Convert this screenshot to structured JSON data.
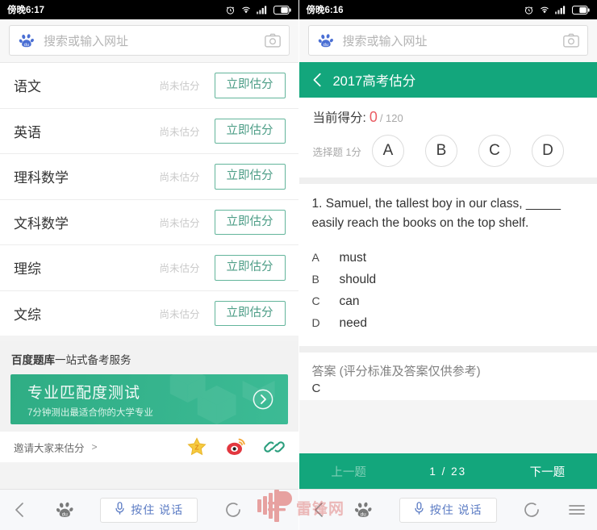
{
  "left": {
    "statusbar": {
      "time": "傍晚6:17",
      "icons": [
        "alarm-icon",
        "wifi-icon",
        "signal-icon",
        "battery-icon"
      ]
    },
    "search": {
      "placeholder": "搜索或输入网址",
      "logo": "baidu-paw-icon",
      "camera": "camera-icon"
    },
    "subjects": [
      {
        "name": "语文",
        "status": "尚未估分",
        "action": "立即估分"
      },
      {
        "name": "英语",
        "status": "尚未估分",
        "action": "立即估分"
      },
      {
        "name": "理科数学",
        "status": "尚未估分",
        "action": "立即估分"
      },
      {
        "name": "文科数学",
        "status": "尚未估分",
        "action": "立即估分"
      },
      {
        "name": "理综",
        "status": "尚未估分",
        "action": "立即估分"
      },
      {
        "name": "文综",
        "status": "尚未估分",
        "action": "立即估分"
      }
    ],
    "promo": {
      "section_title_bold": "百度题库",
      "section_title_rest": "一站式备考服务",
      "banner_title": "专业匹配度测试",
      "banner_subtitle": "7分钟测出最适合你的大学专业",
      "banner_arrow": "chevron-right-circle-icon"
    },
    "invite": {
      "label": "邀请大家来估分",
      "arrow": ">",
      "icons": [
        "qzone-star-icon",
        "weibo-icon",
        "copy-link-icon"
      ]
    },
    "browser_nav": {
      "back": "back-chevron-icon",
      "home": "baidu-paw-icon",
      "voice_label": "按住 说话",
      "mic": "microphone-icon",
      "refresh": "refresh-icon"
    }
  },
  "right": {
    "statusbar": {
      "time": "傍晚6:16",
      "icons": [
        "alarm-icon",
        "wifi-icon",
        "signal-icon",
        "battery-icon"
      ]
    },
    "search": {
      "placeholder": "搜索或输入网址",
      "logo": "baidu-paw-icon",
      "camera": "camera-icon"
    },
    "header": {
      "back": "back-chevron-icon",
      "title": "2017高考估分"
    },
    "score": {
      "label": "当前得分:",
      "value": "0",
      "total": "/ 120",
      "value_color": "#ea5c63"
    },
    "choice": {
      "label": "选择题 1分",
      "options": [
        "A",
        "B",
        "C",
        "D"
      ]
    },
    "question": {
      "stem": "1. Samuel, the tallest boy in our class, _____ easily reach the books on the top shelf.",
      "options": [
        {
          "key": "A",
          "text": "must"
        },
        {
          "key": "B",
          "text": "should"
        },
        {
          "key": "C",
          "text": "can"
        },
        {
          "key": "D",
          "text": "need"
        }
      ]
    },
    "answer": {
      "title": "答案 (评分标准及答案仅供参考)",
      "value": "C"
    },
    "pager": {
      "prev": "上一题",
      "index": "1 / 23",
      "next": "下一题"
    },
    "browser_nav": {
      "back": "back-chevron-icon",
      "home": "baidu-paw-icon",
      "voice_label": "按住 说话",
      "mic": "microphone-icon",
      "refresh": "refresh-icon",
      "menu": "hamburger-menu-icon"
    }
  },
  "watermark": {
    "text": "雷锋网",
    "logo": "leiphone-logo-icon",
    "color": "#d9524f"
  },
  "theme": {
    "accent_green": "#13a67c",
    "button_border": "#63b59b",
    "banner_green": "#35b38c"
  }
}
